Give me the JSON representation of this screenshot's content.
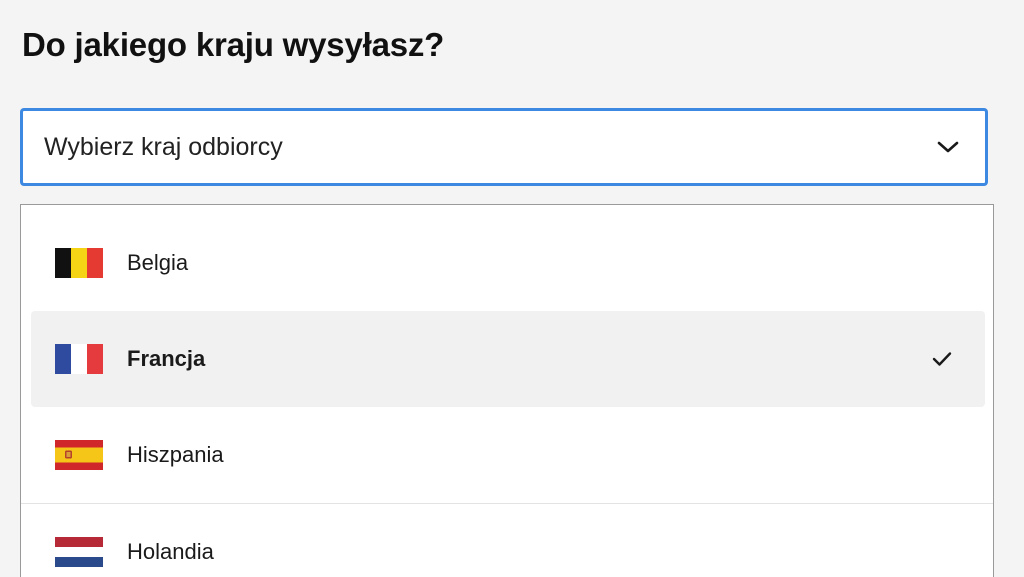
{
  "heading": "Do jakiego kraju wysyłasz?",
  "country_select": {
    "placeholder": "Wybierz kraj odbiorcy",
    "chevron_icon": "chevron-down-icon",
    "border_color": "#3d88e0"
  },
  "options": [
    {
      "label": "Belgia",
      "flag_icon": "belgium-flag-icon",
      "selected": false
    },
    {
      "label": "Francja",
      "flag_icon": "france-flag-icon",
      "selected": true,
      "selected_icon": "checkmark-icon"
    },
    {
      "label": "Hiszpania",
      "flag_icon": "spain-flag-icon",
      "selected": false
    },
    {
      "label": "Holandia",
      "flag_icon": "netherlands-flag-icon",
      "selected": false
    }
  ],
  "colors": {
    "accent": "#3d88e0",
    "selected_row_bg": "#f1f1f1",
    "list_border": "#9a9a9a"
  }
}
